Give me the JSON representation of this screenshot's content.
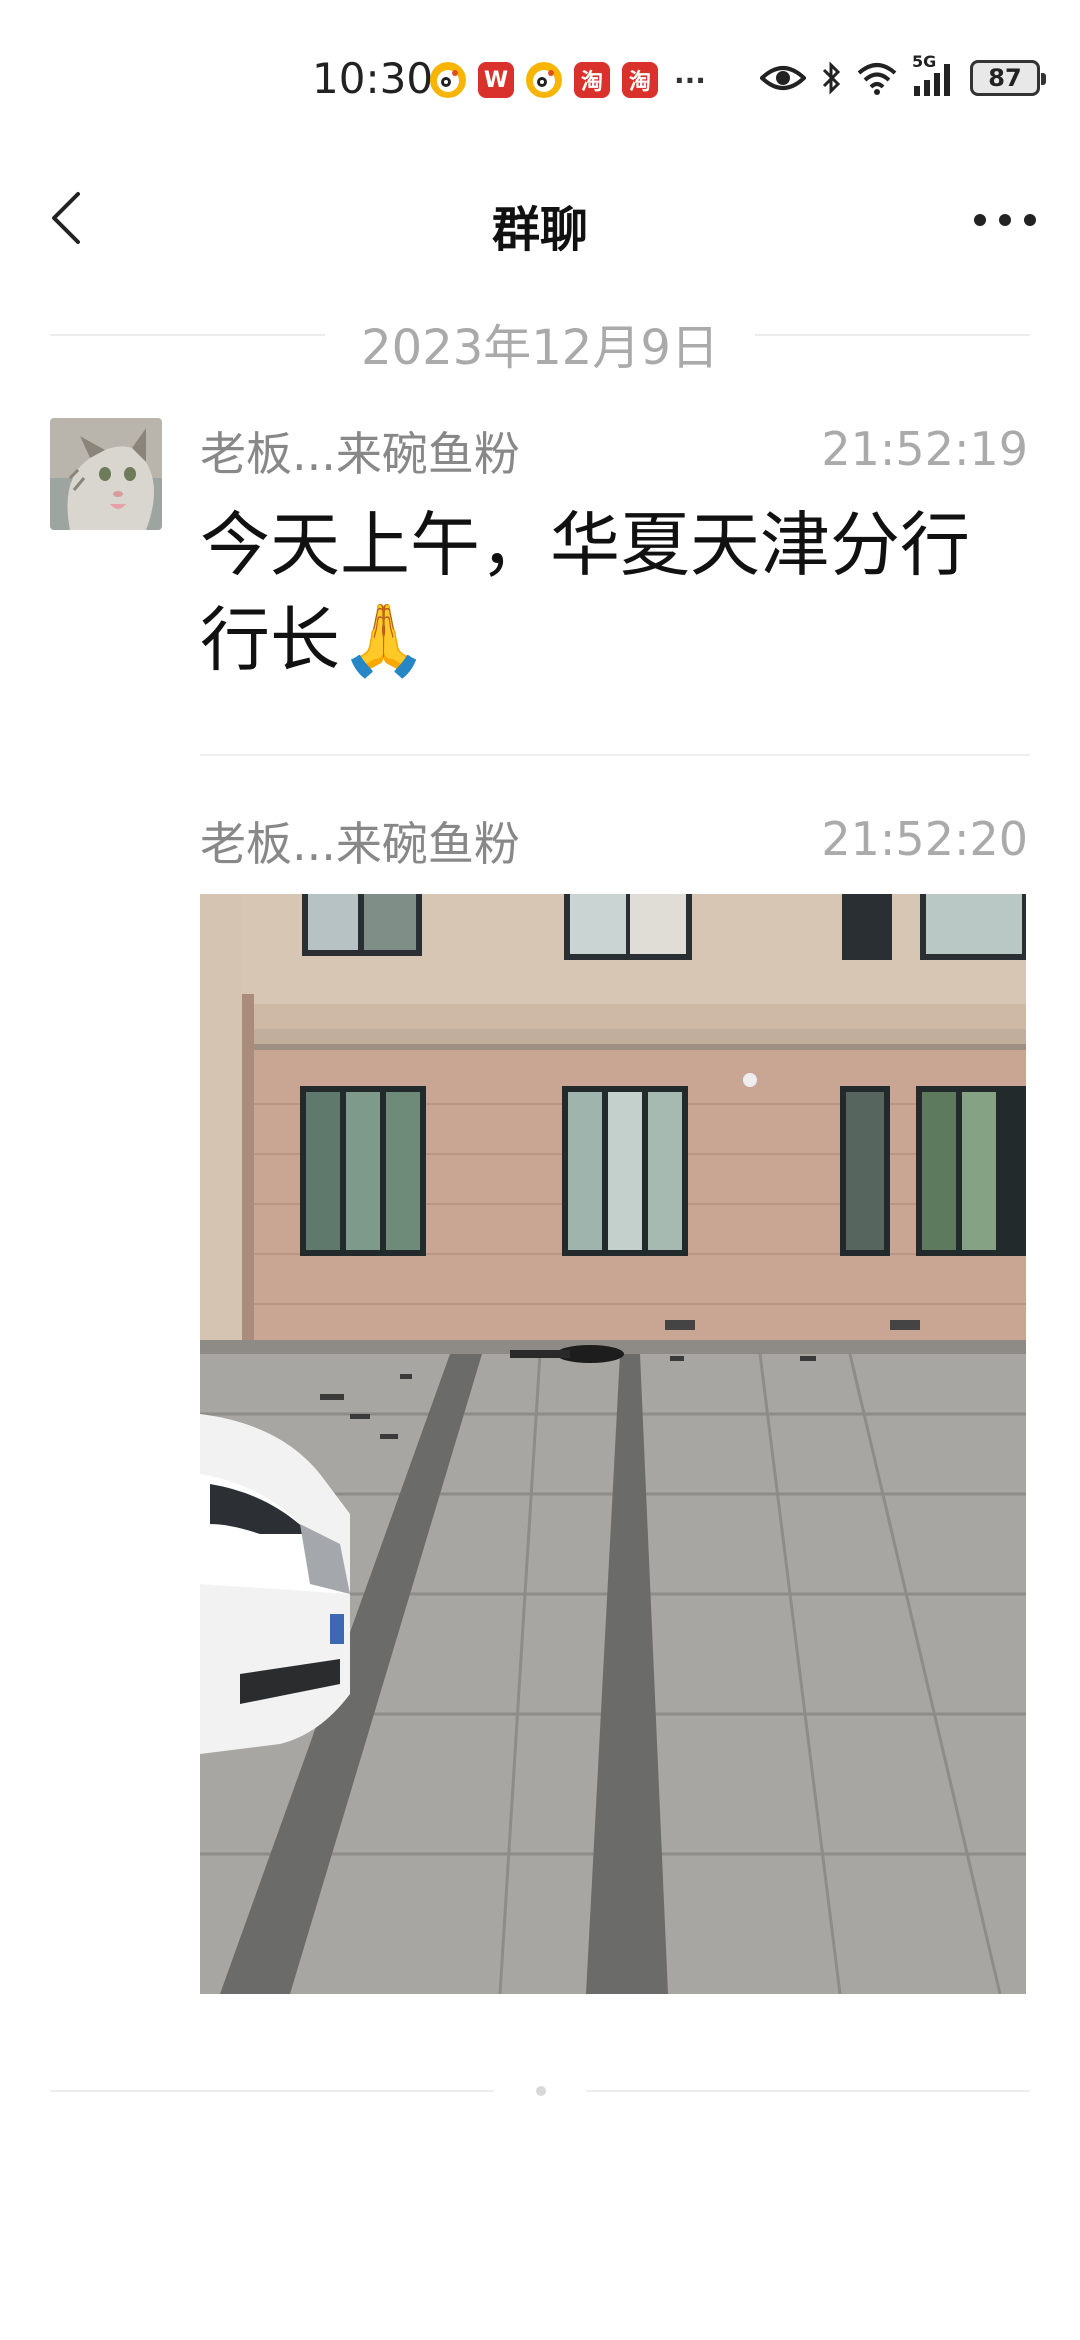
{
  "status_bar": {
    "time": "10:30",
    "notifications": [
      "weibo-icon",
      "wps-icon",
      "weibo-icon",
      "taobao-icon",
      "taobao-icon"
    ],
    "wps_label": "W",
    "taobao_label": "淘",
    "more": "···",
    "network": "5G",
    "battery": "87"
  },
  "nav": {
    "title": "群聊"
  },
  "date_divider": "2023年12月9日",
  "messages": [
    {
      "sender": "老板...来碗鱼粉",
      "time": "21:52:19",
      "text": "今天上午，华夏天津分行行长🙏"
    },
    {
      "sender": "老板...来碗鱼粉",
      "time": "21:52:20",
      "image": "photo-of-building-courtyard"
    }
  ],
  "colors": {
    "accent_gray": "#aaaaaa",
    "text_dark": "#111111",
    "divider": "#ececec"
  }
}
